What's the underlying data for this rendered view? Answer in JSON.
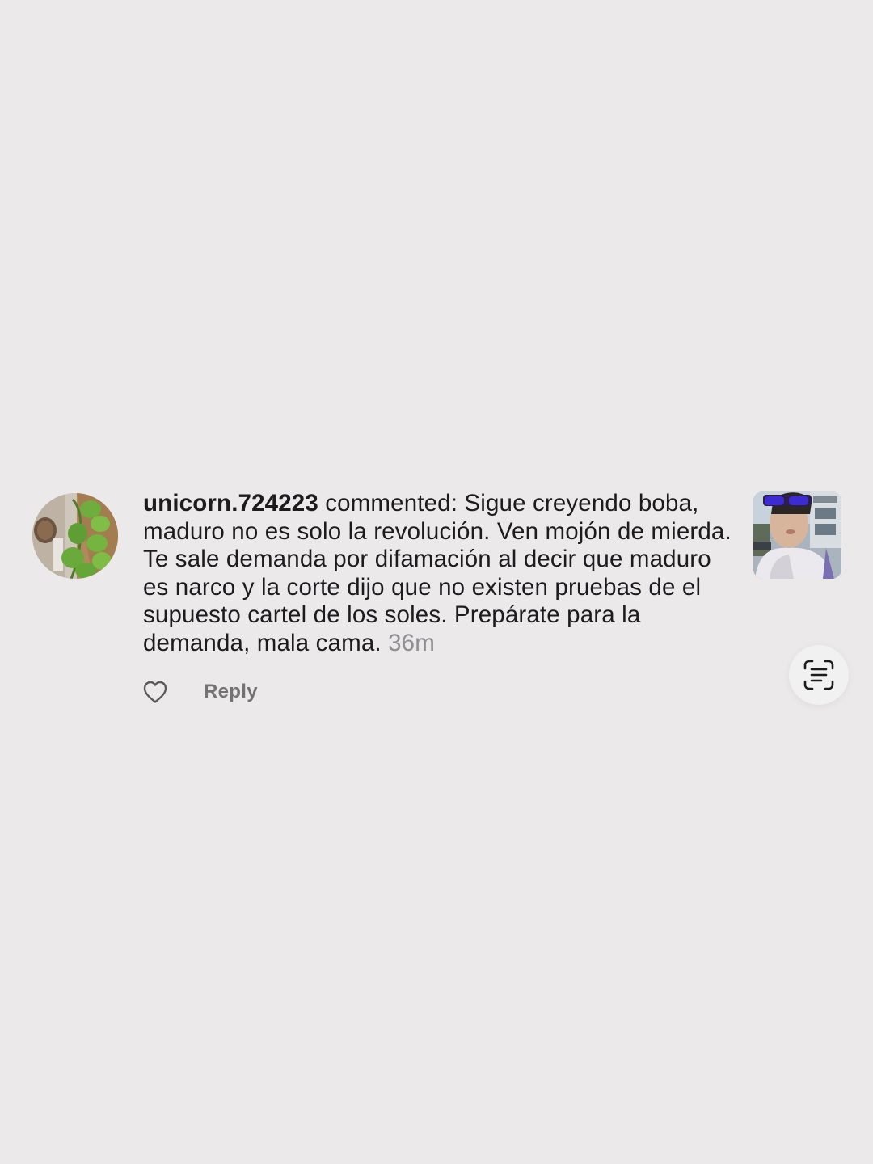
{
  "notification": {
    "username": "unicorn.724223",
    "comment_text": " commented: Sigue creyendo boba, maduro no es solo la revolución. Ven mojón de mierda. Te sale demanda por difamación al decir que maduro es narco y la corte dijo que no existen pruebas de el supuesto cartel de los soles. Prepárate para la demanda, mala cama.",
    "timestamp": "36m",
    "reply_label": "Reply"
  },
  "icons": {
    "like": "heart-outline-icon",
    "scan": "scan-text-icon"
  }
}
